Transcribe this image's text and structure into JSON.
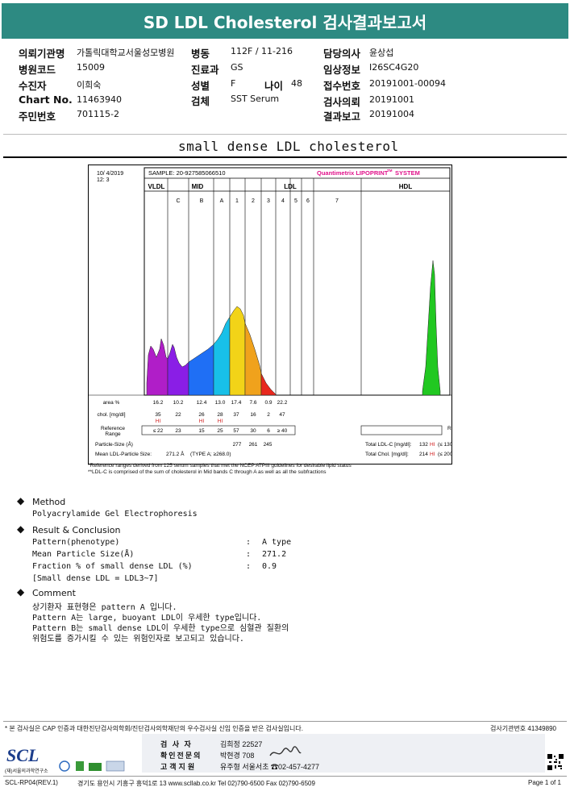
{
  "report": {
    "title": "SD LDL Cholesterol 검사결과보고서",
    "header": {
      "institution_label": "의뢰기관명",
      "institution": "가톨릭대학교서울성모병원",
      "ward_label": "병동",
      "ward": "112F / 11-216",
      "doctor_label": "담당의사",
      "doctor": "윤상섭",
      "hospital_code_label": "병원코드",
      "hospital_code": "15009",
      "dept_label": "진료과",
      "dept": "GS",
      "clinical_info_label": "임상정보",
      "clinical_info": "I26SC4G20",
      "patient_label": "수진자",
      "patient": "이희숙",
      "sex_label": "성별",
      "sex": "F",
      "age_label": "나이",
      "age": "48",
      "receipt_label": "접수번호",
      "receipt": "20191001-00094",
      "chart_label": "Chart No.",
      "chart": "11463940",
      "specimen_label": "검체",
      "specimen": "SST Serum",
      "request_label": "검사의뢰",
      "request_date": "20191001",
      "id_label": "주민번호",
      "id": "701115-2",
      "result_label": "결과보고",
      "result_date": "20191004"
    },
    "section_title": "small dense LDL cholesterol"
  },
  "chart_data": {
    "type": "area",
    "date": "10/ 4/2019",
    "time": "12: 3",
    "sample": "SAMPLE: 20-927585066510",
    "system": "Quantimetrix LIPOPRINT",
    "system_tm": "TM",
    "system_tail": "SYSTEM",
    "bands": [
      "VLDL",
      "MID",
      "LDL",
      "HDL"
    ],
    "fractions": [
      "C",
      "B",
      "A",
      "1",
      "2",
      "3",
      "4",
      "5",
      "6",
      "7"
    ],
    "rows": {
      "area_label": "area %",
      "chol_label": "chol. [mg/dl]",
      "ref_label": "Reference Range",
      "ref_label_right": "Reference Range",
      "area": [
        "16.2",
        "10.2",
        "12.4",
        "13.0",
        "17.4",
        "7.6",
        "0.9",
        "22.2"
      ],
      "chol": [
        "35",
        "22",
        "26",
        "28",
        "37",
        "16",
        "2",
        "47"
      ],
      "chol_flags": [
        "HI",
        "",
        "HI",
        "HI",
        "",
        "",
        "",
        ""
      ],
      "ref": [
        "≤ 22",
        "23",
        "15",
        "25",
        "57",
        "30",
        "6",
        "≥ 40"
      ]
    },
    "particle_size_label": "Particle-Size (Å)",
    "particle_sizes": [
      "277",
      "261",
      "245"
    ],
    "mean_label": "Mean LDL-Particle Size:",
    "mean_value": "271.2 Å",
    "mean_type": "(TYPE A; ≥268.0)",
    "total_ldl_label": "Total LDL-C [mg/dl]:",
    "total_ldl": "132",
    "total_ldl_flag": "HI",
    "total_ldl_ref": "(≤ 130)",
    "total_chol_label": "Total Chol. [mg/dl]:",
    "total_chol": "214",
    "total_chol_flag": "HI",
    "total_chol_ref": "(≤ 200)",
    "footnote1": "*Reference ranges derived from 125 serum samples that met the NCEP ATPIII guidelines for desirable lipid status",
    "footnote2": "**LDL-C is comprised of the sum of cholesterol in Mid bands C through A as well as all the subfractions",
    "colors": {
      "vldl": "#b01ec8",
      "mid_c": "#8a1ee6",
      "mid_b": "#1f6ff5",
      "mid_a": "#18c0e8",
      "ldl1": "#f2d318",
      "ldl2": "#f0a21c",
      "ldl3": "#e8281e",
      "hdl": "#21c821",
      "title_bar": "#2d8a82",
      "system": "#e0118a"
    }
  },
  "method": {
    "title": "Method",
    "text": "Polyacrylamide Gel Electrophoresis"
  },
  "result": {
    "title": "Result & Conclusion",
    "rows": [
      {
        "label": "Pattern(phenotype)",
        "sep": ":",
        "value": "A type"
      },
      {
        "label": "Mean Particle Size(Å)",
        "sep": ":",
        "value": "271.2"
      },
      {
        "label": "Fraction % of small dense LDL (%)",
        "sep": ":",
        "value": "0.9"
      }
    ],
    "note": "[Small dense LDL = LDL3~7]"
  },
  "comment": {
    "title": "Comment",
    "lines": [
      "상기환자 표현형은 pattern A 입니다.",
      "Pattern A는 large, buoyant LDL이 우세한 type입니다.",
      "Pattern B는 small dense LDL이 우세한 type으로 심혈관 질환의",
      "위험도를 증가시킬 수 있는 위험인자로 보고되고 있습니다."
    ]
  },
  "footer": {
    "certification": "* 본 검사실은 CAP 인증과 대한진단검사의학회/진단검사의학재단의 우수검사실 신임 인증을 받은 검사실입니다.",
    "license": "검사기관번호 41349890",
    "tester_label": "검 사 자",
    "tester": "김희정 22527",
    "confirm_label": "확인전문의",
    "confirm": "박현경 708",
    "service_label": "고객지원",
    "service": "유주형 서울서초 ☎02-457-4277",
    "org_name": "SCL",
    "org_sub": "(재)서울의과학연구소",
    "doc_code": "SCL-RP04(REV.1)",
    "address": "경기도 용인시 기흥구 흥덕1로 13  www.scllab.co.kr Tel 02)790-6500 Fax 02)790-6509",
    "page": "Page 1 of 1"
  }
}
